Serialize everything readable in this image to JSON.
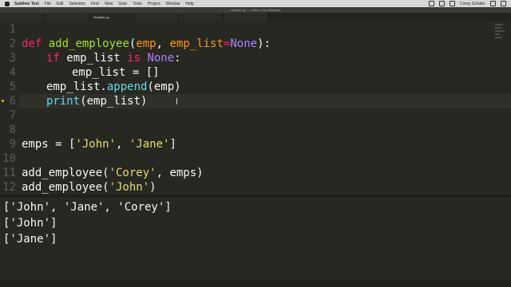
{
  "menubar": {
    "app": "Sublime Text",
    "items": [
      "File",
      "Edit",
      "Selection",
      "Find",
      "View",
      "Goto",
      "Tools",
      "Project",
      "Window",
      "Help"
    ],
    "user": "Corey Schafer"
  },
  "window": {
    "title": "mutable.py — Python-Top-Mistakes"
  },
  "tabs": [
    "",
    "",
    "mutable.py",
    "",
    "",
    ""
  ],
  "editor": {
    "line_numbers": [
      "1",
      "2",
      "3",
      "4",
      "5",
      "6",
      "7",
      "8",
      "9",
      "10",
      "11",
      "12"
    ],
    "code": {
      "l2_def": "def",
      "l2_fn": "add_employee",
      "l2_open": "(",
      "l2_arg1": "emp",
      "l2_comma": ", ",
      "l2_arg2": "emp_list",
      "l2_eq": "=",
      "l2_none": "None",
      "l2_close": "):",
      "l3_if": "if",
      "l3_var": " emp_list ",
      "l3_is": "is",
      "l3_sp": " ",
      "l3_none": "None",
      "l3_colon": ":",
      "l4": "emp_list = []",
      "l5_a": "emp_list.",
      "l5_fn": "append",
      "l5_b": "(emp)",
      "l6_fn": "print",
      "l6_b": "(emp_list)",
      "l9_a": "emps = [",
      "l9_s1": "'John'",
      "l9_c": ", ",
      "l9_s2": "'Jane'",
      "l9_b": "]",
      "l11_a": "add_employee(",
      "l11_s": "'Corey'",
      "l11_b": ", emps)",
      "l12_a": "add_employee(",
      "l12_s": "'John'",
      "l12_b": ")"
    }
  },
  "output": {
    "lines": [
      "['John', 'Jane', 'Corey']",
      "['John']",
      "['Jane']"
    ]
  },
  "colors": {
    "background": "#272822",
    "keyword": "#f92672",
    "function": "#a6e22e",
    "argument": "#fd971f",
    "constant": "#ae81ff",
    "string": "#e6db74",
    "builtin": "#66d9ef"
  }
}
